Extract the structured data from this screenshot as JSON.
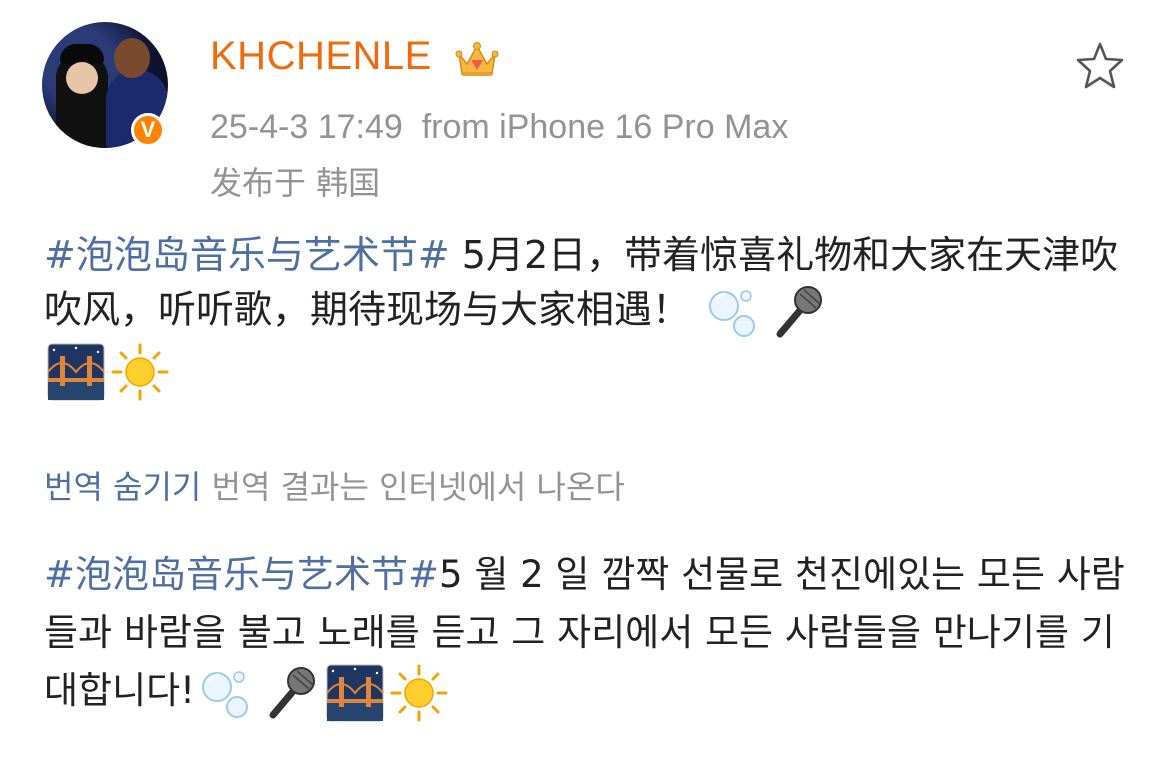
{
  "post": {
    "username": "KHCHENLE",
    "timestamp": "25-4-3 17:49",
    "source": "from iPhone 16 Pro Max",
    "location": "发布于 韩国",
    "content_cn": {
      "hashtag": "#泡泡岛音乐与艺术节#",
      "text": " 5月2日，带着惊喜礼物和大家在天津吹吹风，听听歌，期待现场与大家相遇！"
    },
    "translation": {
      "toggle_label": "번역 숨기기",
      "note": "번역 결과는 인터넷에서 나온다"
    },
    "content_kr": {
      "hashtag": "#泡泡岛音乐与艺术节#",
      "text": "5 월 2 일 깜짝 선물로 천진에있는 모든 사람들과 바람을 불고 노래를 듣고 그 자리에서 모든 사람들을 만나기를 기대합니다!"
    },
    "emojis": [
      "bubbles-icon",
      "microphone-icon",
      "bridge-at-night-icon",
      "sun-icon"
    ]
  },
  "colors": {
    "username": "#f06a0c",
    "hashtag": "#4e6fa3",
    "meta": "#939393",
    "verified_badge": "#ff8200"
  }
}
